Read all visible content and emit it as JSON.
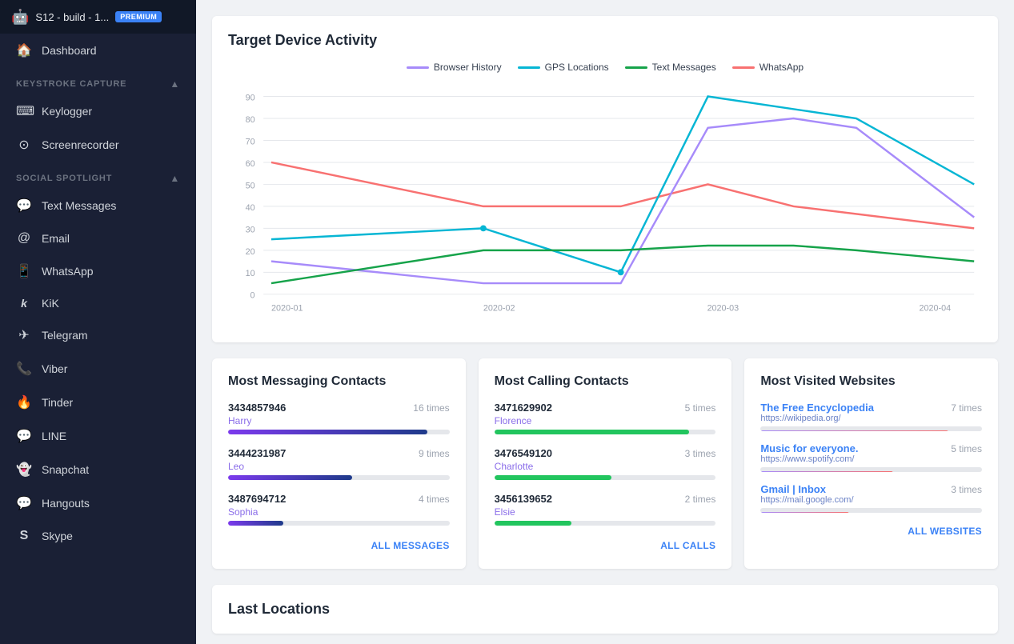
{
  "sidebar": {
    "device_name": "S12 - build - 1...",
    "premium_label": "PREMIUM",
    "nav_main": [
      {
        "id": "dashboard",
        "icon": "🏠",
        "label": "Dashboard"
      }
    ],
    "section_keystroke": "KEYSTROKE CAPTURE",
    "keystroke_items": [
      {
        "id": "keylogger",
        "icon": "⌨",
        "label": "Keylogger"
      },
      {
        "id": "screenrecorder",
        "icon": "⊙",
        "label": "Screenrecorder"
      }
    ],
    "section_social": "SOCIAL SPOTLIGHT",
    "social_items": [
      {
        "id": "textmessages",
        "icon": "💬",
        "label": "Text Messages"
      },
      {
        "id": "email",
        "icon": "✉",
        "label": "Email"
      },
      {
        "id": "whatsapp",
        "icon": "📱",
        "label": "WhatsApp"
      },
      {
        "id": "kik",
        "icon": "k",
        "label": "KiK"
      },
      {
        "id": "telegram",
        "icon": "✈",
        "label": "Telegram"
      },
      {
        "id": "viber",
        "icon": "📞",
        "label": "Viber"
      },
      {
        "id": "tinder",
        "icon": "🔥",
        "label": "Tinder"
      },
      {
        "id": "line",
        "icon": "💬",
        "label": "LINE"
      },
      {
        "id": "snapchat",
        "icon": "👻",
        "label": "Snapchat"
      },
      {
        "id": "hangouts",
        "icon": "💬",
        "label": "Hangouts"
      },
      {
        "id": "skype",
        "icon": "S",
        "label": "Skype"
      }
    ]
  },
  "chart": {
    "title": "Target Device Activity",
    "legend": [
      {
        "id": "browser",
        "label": "Browser History",
        "color": "#a78bfa"
      },
      {
        "id": "gps",
        "label": "GPS Locations",
        "color": "#06b6d4"
      },
      {
        "id": "sms",
        "label": "Text Messages",
        "color": "#16a34a"
      },
      {
        "id": "whatsapp",
        "label": "WhatsApp",
        "color": "#f87171"
      }
    ],
    "x_labels": [
      "2020-01",
      "2020-02",
      "2020-03",
      "2020-04"
    ],
    "y_labels": [
      "0",
      "10",
      "20",
      "30",
      "40",
      "50",
      "60",
      "70",
      "80",
      "90"
    ]
  },
  "messaging": {
    "title": "Most Messaging Contacts",
    "contacts": [
      {
        "number": "3434857946",
        "name": "Harry",
        "times": "16 times",
        "bar_class": "bar-msg-1"
      },
      {
        "number": "3444231987",
        "name": "Leo",
        "times": "9 times",
        "bar_class": "bar-msg-2"
      },
      {
        "number": "3487694712",
        "name": "Sophia",
        "times": "4 times",
        "bar_class": "bar-msg-3"
      }
    ],
    "all_link": "ALL MESSAGES"
  },
  "calling": {
    "title": "Most Calling Contacts",
    "contacts": [
      {
        "number": "3471629902",
        "name": "Florence",
        "times": "5 times",
        "bar_class": "bar-call-1"
      },
      {
        "number": "3476549120",
        "name": "Charlotte",
        "times": "3 times",
        "bar_class": "bar-call-2"
      },
      {
        "number": "3456139652",
        "name": "Elsie",
        "times": "2 times",
        "bar_class": "bar-call-3"
      }
    ],
    "all_link": "ALL CALLS"
  },
  "websites": {
    "title": "Most Visited Websites",
    "items": [
      {
        "title": "The Free Encyclopedia",
        "url": "https://wikipedia.org/",
        "times": "7 times",
        "bar_class": "bar-web-1"
      },
      {
        "title": "Music for everyone.",
        "url": "https://www.spotify.com/",
        "times": "5 times",
        "bar_class": "bar-web-2"
      },
      {
        "title": "Gmail | Inbox",
        "url": "https://mail.google.com/",
        "times": "3 times",
        "bar_class": "bar-web-3"
      }
    ],
    "all_link": "ALL WEBSITES"
  },
  "last_locations": {
    "title": "Last Locations"
  }
}
